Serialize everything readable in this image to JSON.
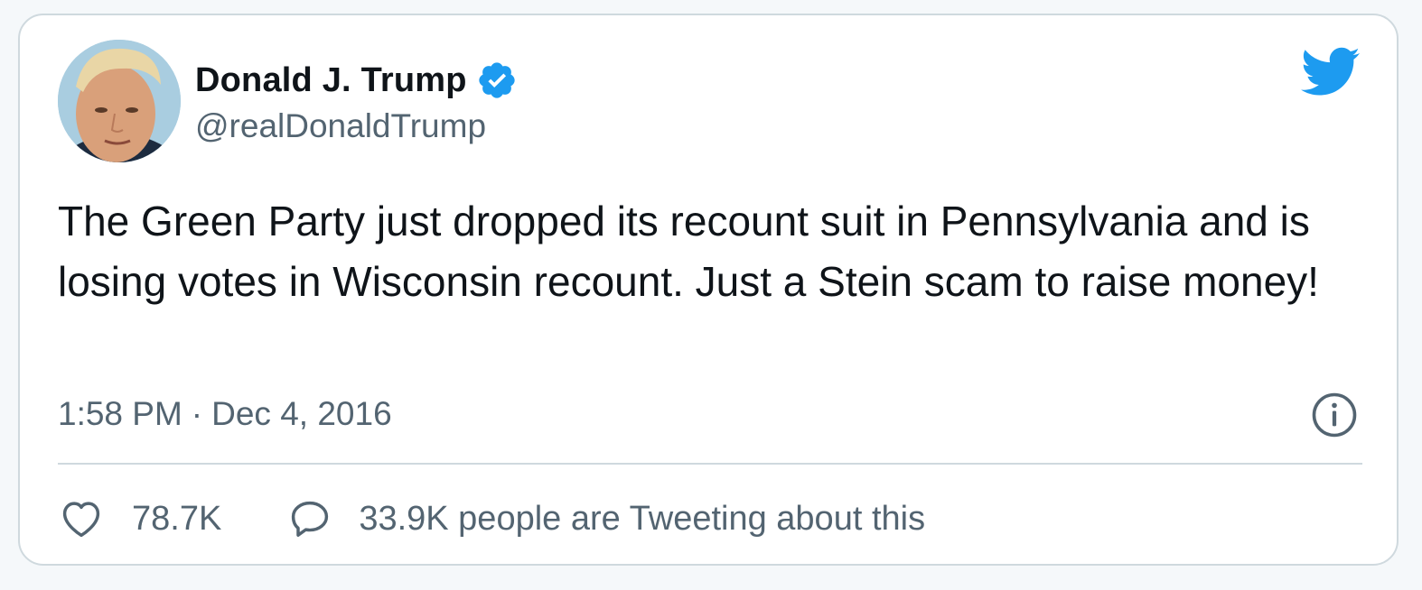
{
  "author": {
    "display_name": "Donald J. Trump",
    "handle": "@realDonaldTrump",
    "verified": true,
    "avatar_icon": "profile-photo"
  },
  "tweet": {
    "text": "The Green Party just dropped its recount suit in Pennsylvania and is losing votes in Wisconsin recount. Just a Stein scam to raise money!",
    "time": "1:58 PM",
    "separator": "·",
    "date": "Dec 4, 2016"
  },
  "stats": {
    "likes": "78.7K",
    "conversation": "33.9K people are Tweeting about this"
  },
  "icons": {
    "brand": "twitter-bird-icon",
    "info": "info-icon",
    "like": "heart-icon",
    "reply": "speech-bubble-icon",
    "verified": "verified-badge-icon"
  },
  "colors": {
    "brand_blue": "#1d9bf0",
    "text_primary": "#0f1419",
    "text_secondary": "#536471",
    "border": "#cfd9de"
  }
}
